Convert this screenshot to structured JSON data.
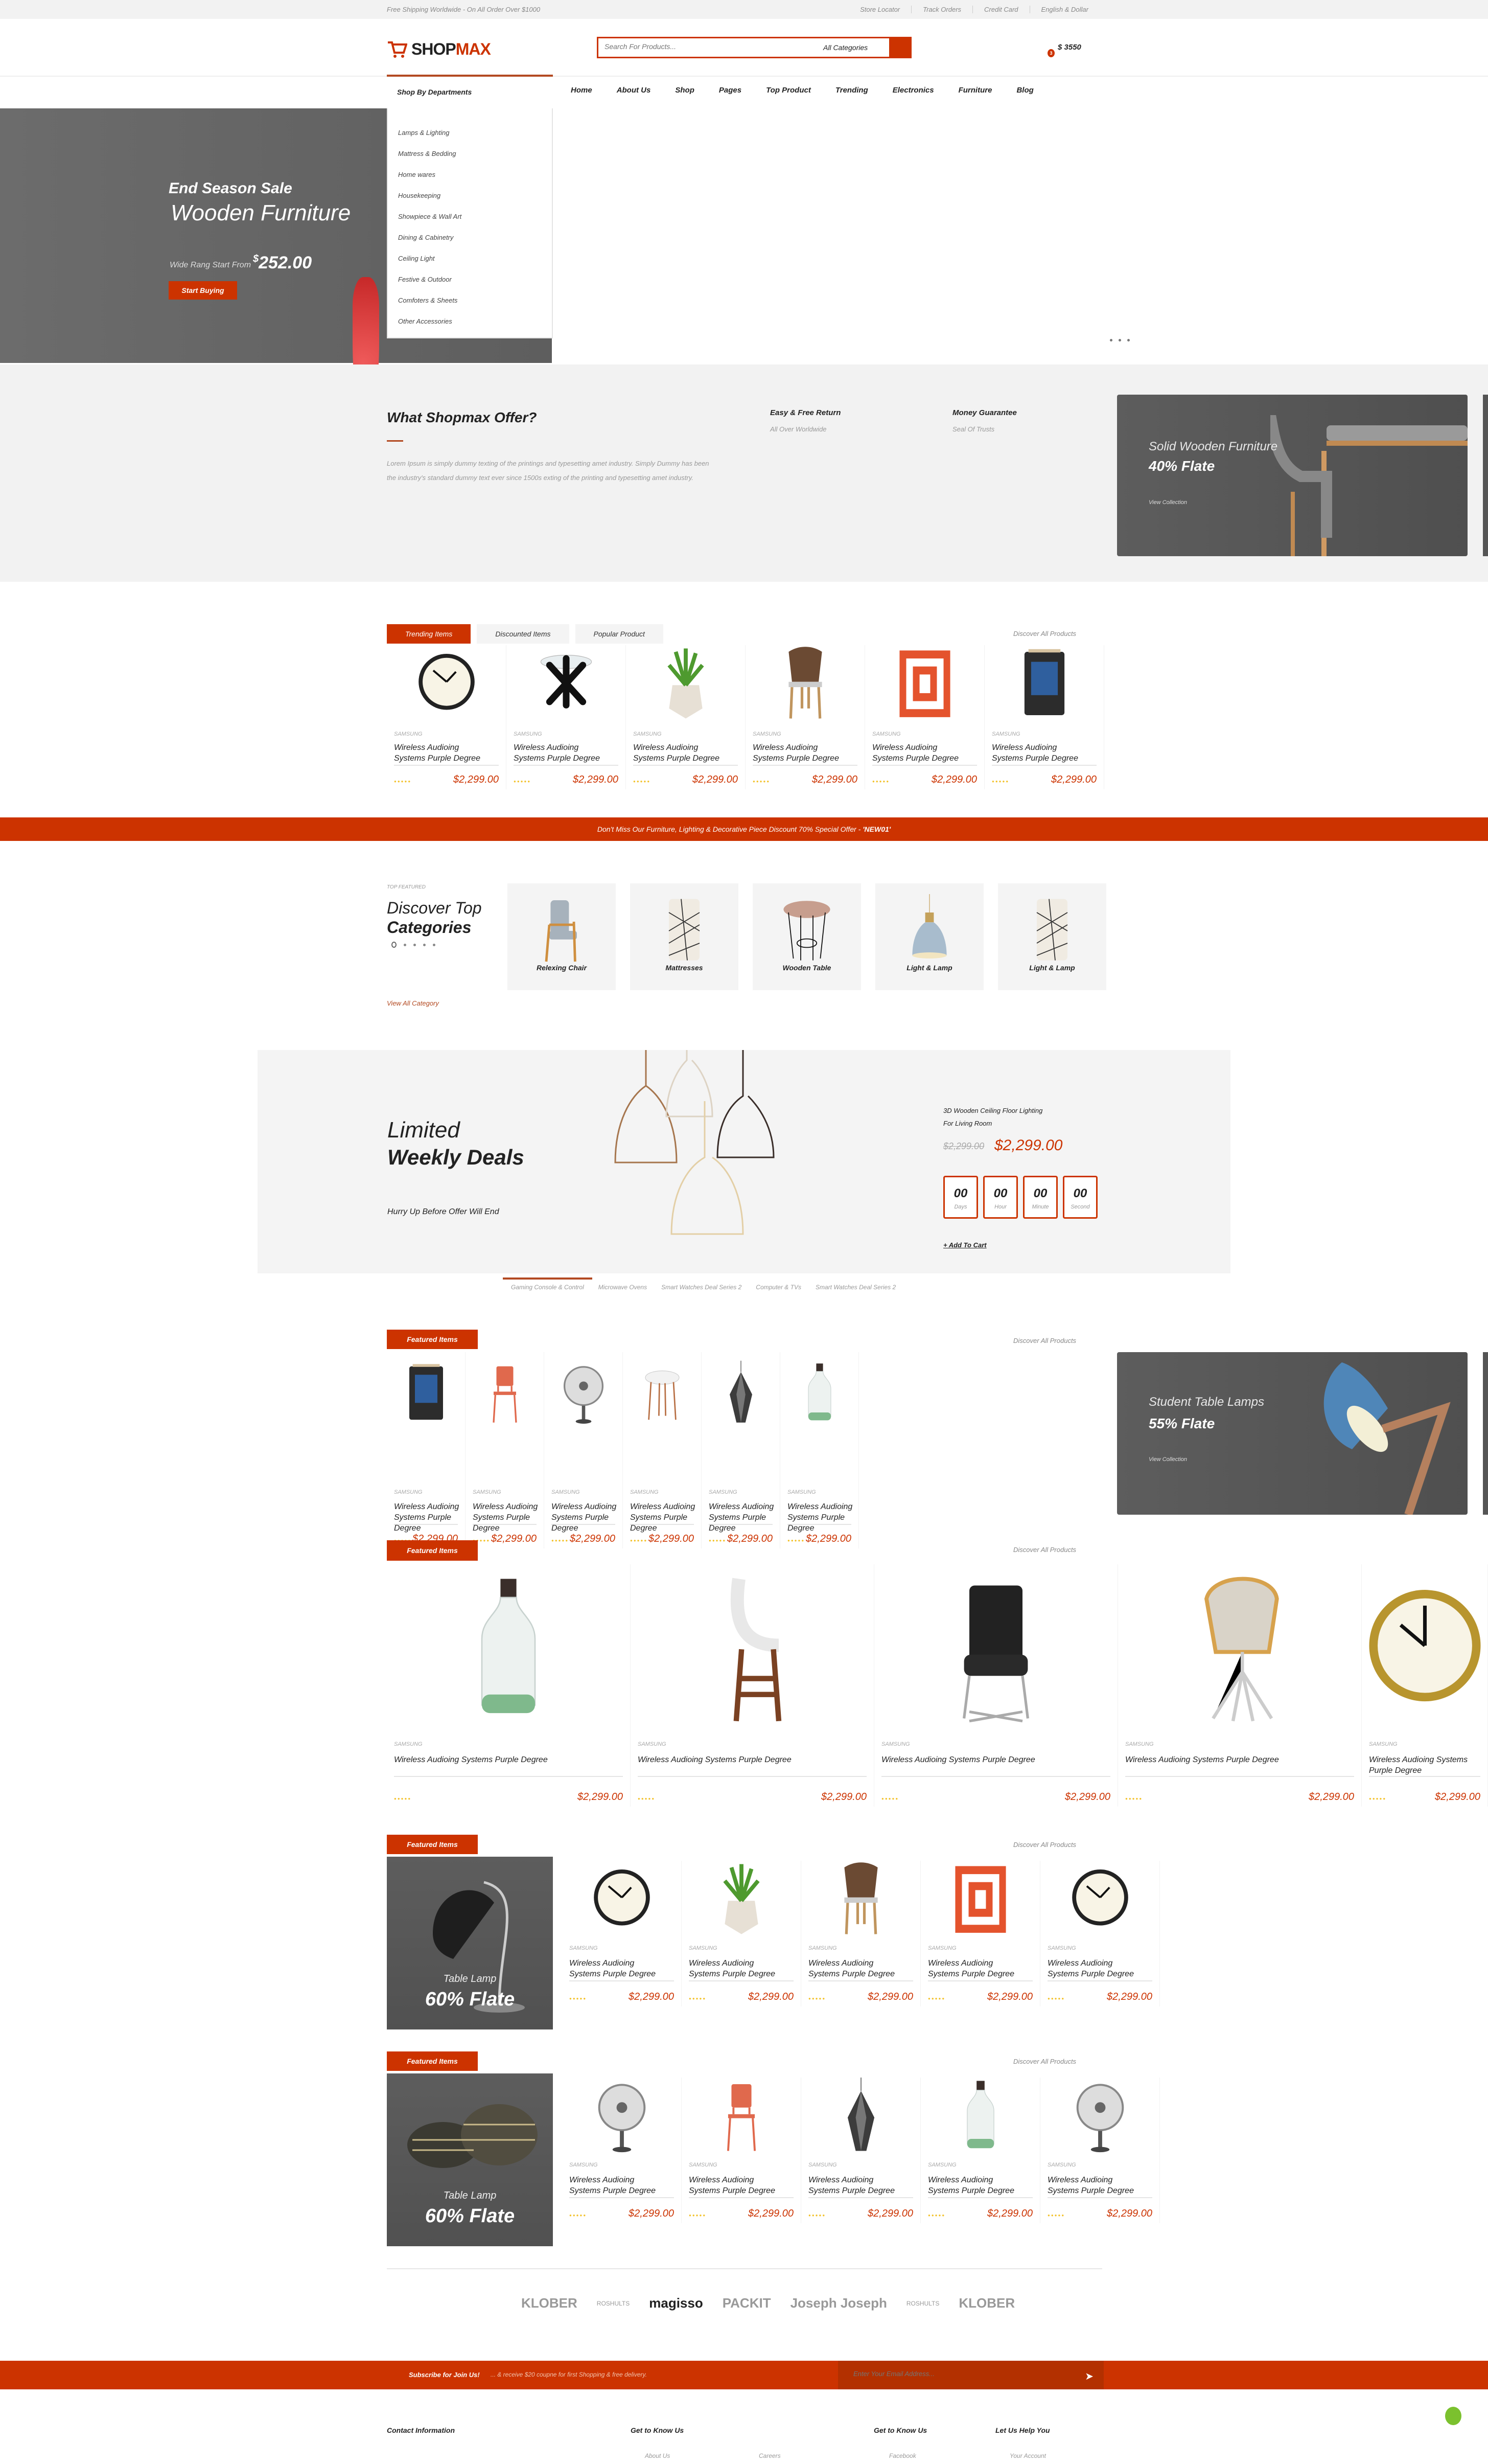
{
  "topbar": {
    "promo": "Free Shipping Worldwide - On All Order Over $1000",
    "links": [
      "Store Locator",
      "Track Orders",
      "Credit Card",
      "English & Dollar"
    ]
  },
  "header": {
    "logo_a": "SHOP",
    "logo_b": "MAX",
    "search_placeholder": "Search For Products...",
    "category": "All Categories",
    "cart_count": "3",
    "cart_total": "$ 3550"
  },
  "nav": {
    "departments_label": "Shop By Departments",
    "items": [
      "Home",
      "About Us",
      "Shop",
      "Pages",
      "Top Product",
      "Trending",
      "Electronics",
      "Furniture",
      "Blog"
    ]
  },
  "departments": [
    "Lamps & Lighting",
    "Mattress & Bedding",
    "Home wares",
    "Housekeeping",
    "Showpiece & Wall Art",
    "Dining & Cabinetry",
    "Ceiling Light",
    "Festive & Outdoor",
    "Comfoters & Sheets",
    "Other Accessories"
  ],
  "hero": {
    "kicker": "End Season Sale",
    "title": "Wooden Furniture",
    "price_label": "Wide Rang Start From",
    "currency": "$",
    "price": "252.00",
    "button": "Start Buying",
    "slides": 3,
    "active_slide": 0
  },
  "offer": {
    "title": "What Shopmax Offer?",
    "body": "Lorem Ipsum is simply dummy texting of the printings and typesetting amet industry. Simply Dummy has been the industry's standard dummy text ever since 1500s exting of the printing and typesetting amet industry.",
    "features": [
      {
        "title": "Easy & Free Return",
        "sub": "All Over Worldwide"
      },
      {
        "title": "Money Guarantee",
        "sub": "Seal Of Trusts"
      }
    ],
    "banner": {
      "title": "Solid Wooden Furniture",
      "discount": "40% Flate",
      "link": "View Collection"
    }
  },
  "trending": {
    "tabs": [
      "Trending Items",
      "Discounted Items",
      "Popular Product"
    ],
    "active_tab": 0,
    "discover": "Discover All Products",
    "products": [
      {
        "brand": "SAMSUNG",
        "name": "Wireless Audioing Systems Purple Degree",
        "price": "$2,299.00",
        "image": "clock"
      },
      {
        "brand": "SAMSUNG",
        "name": "Wireless Audioing Systems Purple Degree",
        "price": "$2,299.00",
        "image": "glass-table"
      },
      {
        "brand": "SAMSUNG",
        "name": "Wireless Audioing Systems Purple Degree",
        "price": "$2,299.00",
        "image": "plant"
      },
      {
        "brand": "SAMSUNG",
        "name": "Wireless Audioing Systems Purple Degree",
        "price": "$2,299.00",
        "image": "wood-chair"
      },
      {
        "brand": "SAMSUNG",
        "name": "Wireless Audioing Systems Purple Degree",
        "price": "$2,299.00",
        "image": "pillow"
      },
      {
        "brand": "SAMSUNG",
        "name": "Wireless Audioing Systems Purple Degree",
        "price": "$2,299.00",
        "image": "magazine-rack"
      }
    ]
  },
  "promo_strip": {
    "text": "Don't Miss Our Furniture, Lighting & Decorative Piece Discount 70% Special Offer - ",
    "code": "'NEW01'"
  },
  "categories": {
    "eyebrow": "TOP FEATURED",
    "title_light": "Discover Top",
    "title_bold": "Categories",
    "view_all": "View All Category",
    "items": [
      {
        "name": "Relexing Chair",
        "image": "armchair"
      },
      {
        "name": "Mattresses",
        "image": "cushion"
      },
      {
        "name": "Wooden Table",
        "image": "wire-table"
      },
      {
        "name": "Light & Lamp",
        "image": "pendant"
      },
      {
        "name": "Light & Lamp",
        "image": "cushion"
      }
    ]
  },
  "deals": {
    "title_light": "Limited",
    "title_bold": "Weekly Deals",
    "subtitle": "Hurry Up Before Offer Will End",
    "product_name_1": "3D Wooden Ceiling Floor Lighting",
    "product_name_2": "For Living Room",
    "old_price": "$2,299.00",
    "price": "$2,299.00",
    "countdown": [
      {
        "value": "00",
        "label": "Days"
      },
      {
        "value": "00",
        "label": "Hour"
      },
      {
        "value": "00",
        "label": "Minute"
      },
      {
        "value": "00",
        "label": "Second"
      }
    ],
    "add_to_cart": "+ Add To Cart",
    "tabs": [
      "Gaming Console & Control",
      "Microwave Ovens",
      "Smart Watches Deal Series 2",
      "Computer & TVs",
      "Smart Watches Deal Series 2"
    ],
    "active_tab": 0
  },
  "featured1": {
    "label": "Featured Items",
    "discover": "Discover All Products",
    "banner": {
      "title": "Student Table Lamps",
      "discount": "55% Flate",
      "link": "View Collection"
    },
    "products": [
      {
        "brand": "SAMSUNG",
        "name": "Wireless Audioing Systems Purple Degree",
        "price": "$2,299.00",
        "image": "magazine-rack"
      },
      {
        "brand": "SAMSUNG",
        "name": "Wireless Audioing Systems Purple Degree",
        "price": "$2,299.00",
        "image": "red-chair"
      },
      {
        "brand": "SAMSUNG",
        "name": "Wireless Audioing Systems Purple Degree",
        "price": "$2,299.00",
        "image": "fan"
      },
      {
        "brand": "SAMSUNG",
        "name": "Wireless Audioing Systems Purple Degree",
        "price": "$2,299.00",
        "image": "side-table"
      },
      {
        "brand": "SAMSUNG",
        "name": "Wireless Audioing Systems Purple Degree",
        "price": "$2,299.00",
        "image": "geo-lamp"
      },
      {
        "brand": "SAMSUNG",
        "name": "Wireless Audioing Systems Purple Degree",
        "price": "$2,299.00",
        "image": "bottle"
      }
    ]
  },
  "featured2": {
    "label": "Featured Items",
    "discover": "Discover All Products",
    "products": [
      {
        "brand": "SAMSUNG",
        "name": "Wireless Audioing Systems Purple Degree",
        "price": "$2,299.00",
        "image": "bottle"
      },
      {
        "brand": "SAMSUNG",
        "name": "Wireless Audioing Systems Purple Degree",
        "price": "$2,299.00",
        "image": "bar-stool"
      },
      {
        "brand": "SAMSUNG",
        "name": "Wireless Audioing Systems Purple Degree",
        "price": "$2,299.00",
        "image": "black-chair"
      },
      {
        "brand": "SAMSUNG",
        "name": "Wireless Audioing Systems Purple Degree",
        "price": "$2,299.00",
        "image": "shell-chair"
      },
      {
        "brand": "SAMSUNG",
        "name": "Wireless Audioing Systems Purple Degree",
        "price": "$2,299.00",
        "image": "gold-clock"
      }
    ]
  },
  "featured3": {
    "label": "Featured Items",
    "discover": "Discover All Products",
    "banner": {
      "title": "Table Lamp",
      "discount": "60% Flate"
    },
    "products": [
      {
        "brand": "SAMSUNG",
        "name": "Wireless Audioing Systems Purple Degree",
        "price": "$2,299.00",
        "image": "clock"
      },
      {
        "brand": "SAMSUNG",
        "name": "Wireless Audioing Systems Purple Degree",
        "price": "$2,299.00",
        "image": "plant"
      },
      {
        "brand": "SAMSUNG",
        "name": "Wireless Audioing Systems Purple Degree",
        "price": "$2,299.00",
        "image": "wood-chair"
      },
      {
        "brand": "SAMSUNG",
        "name": "Wireless Audioing Systems Purple Degree",
        "price": "$2,299.00",
        "image": "pillow"
      },
      {
        "brand": "SAMSUNG",
        "name": "Wireless Audioing Systems Purple Degree",
        "price": "$2,299.00",
        "image": "clock"
      }
    ]
  },
  "featured4": {
    "label": "Featured Items",
    "discover": "Discover All Products",
    "banner": {
      "title": "Table Lamp",
      "discount": "60% Flate"
    },
    "products": [
      {
        "brand": "SAMSUNG",
        "name": "Wireless Audioing Systems Purple Degree",
        "price": "$2,299.00",
        "image": "fan"
      },
      {
        "brand": "SAMSUNG",
        "name": "Wireless Audioing Systems Purple Degree",
        "price": "$2,299.00",
        "image": "red-chair"
      },
      {
        "brand": "SAMSUNG",
        "name": "Wireless Audioing Systems Purple Degree",
        "price": "$2,299.00",
        "image": "geo-lamp"
      },
      {
        "brand": "SAMSUNG",
        "name": "Wireless Audioing Systems Purple Degree",
        "price": "$2,299.00",
        "image": "bottle"
      },
      {
        "brand": "SAMSUNG",
        "name": "Wireless Audioing Systems Purple Degree",
        "price": "$2,299.00",
        "image": "fan"
      }
    ]
  },
  "brands": [
    "KLOBER",
    "ROSHULTS",
    "magisso",
    "PACKIT",
    "Joseph Joseph",
    "ROSHULTS",
    "KLOBER"
  ],
  "subscribe": {
    "title": "Subscribe for Join Us!",
    "text": "... & receive $20 coupne for first Shopping & free delivery.",
    "placeholder": "Enter Your Email Address..."
  },
  "footer": {
    "headings": [
      "Contact Information",
      "Get to Know Us",
      "Get to Know Us",
      "Let Us Help You"
    ],
    "links": [
      "About Us",
      "Careers",
      "Facebook",
      "Your Account"
    ]
  },
  "colors": {
    "accent": "#cc3300",
    "accent_dark": "#b34a22",
    "price": "#cc3300",
    "banner": "#555555",
    "star": "#f3c22b"
  }
}
